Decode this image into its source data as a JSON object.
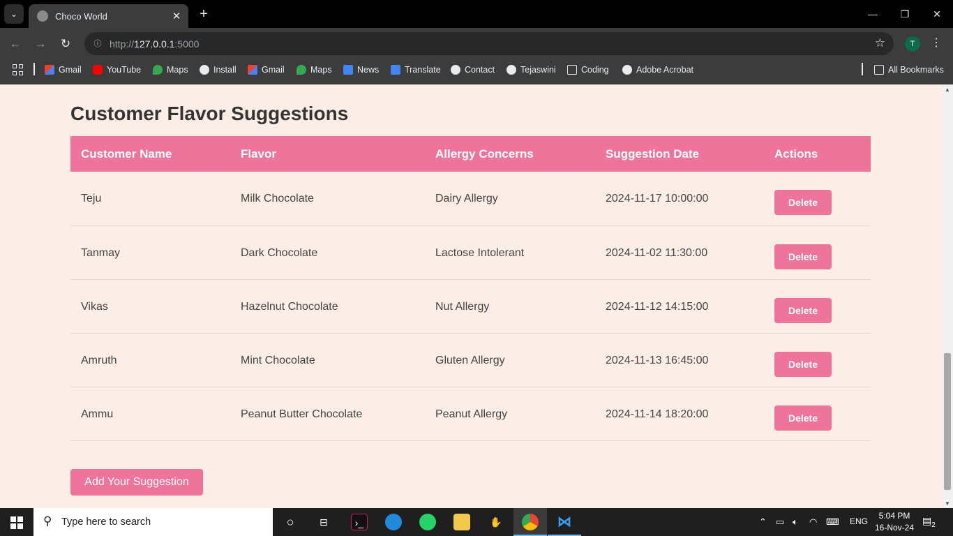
{
  "browser": {
    "tab_title": "Choco World",
    "url_scheme": "http://",
    "url_host": "127.0.0.1",
    "url_port": ":5000",
    "profile_initial": "T",
    "bookmarks": [
      {
        "label": "Gmail",
        "icon": "gmail-icon"
      },
      {
        "label": "YouTube",
        "icon": "youtube-icon"
      },
      {
        "label": "Maps",
        "icon": "maps-icon"
      },
      {
        "label": "Install",
        "icon": "globe-icon"
      },
      {
        "label": "Gmail",
        "icon": "gmail-icon"
      },
      {
        "label": "Maps",
        "icon": "maps-icon"
      },
      {
        "label": "News",
        "icon": "news-icon"
      },
      {
        "label": "Translate",
        "icon": "translate-icon"
      },
      {
        "label": "Contact",
        "icon": "globe-icon"
      },
      {
        "label": "Tejaswini",
        "icon": "globe-icon"
      },
      {
        "label": "Coding",
        "icon": "folder-icon"
      },
      {
        "label": "Adobe Acrobat",
        "icon": "globe-icon"
      }
    ],
    "all_bookmarks": "All Bookmarks"
  },
  "page": {
    "title": "Customer Flavor Suggestions",
    "columns": [
      "Customer Name",
      "Flavor",
      "Allergy Concerns",
      "Suggestion Date",
      "Actions"
    ],
    "rows": [
      {
        "name": "Teju",
        "flavor": "Milk Chocolate",
        "allergy": "Dairy Allergy",
        "date": "2024-11-17 10:00:00",
        "action": "Delete"
      },
      {
        "name": "Tanmay",
        "flavor": "Dark Chocolate",
        "allergy": "Lactose Intolerant",
        "date": "2024-11-02 11:30:00",
        "action": "Delete"
      },
      {
        "name": "Vikas",
        "flavor": "Hazelnut Chocolate",
        "allergy": "Nut Allergy",
        "date": "2024-11-12 14:15:00",
        "action": "Delete"
      },
      {
        "name": "Amruth",
        "flavor": "Mint Chocolate",
        "allergy": "Gluten Allergy",
        "date": "2024-11-13 16:45:00",
        "action": "Delete"
      },
      {
        "name": "Ammu",
        "flavor": "Peanut Butter Chocolate",
        "allergy": "Peanut Allergy",
        "date": "2024-11-14 18:20:00",
        "action": "Delete"
      }
    ],
    "add_button": "Add Your Suggestion",
    "accent_color": "#ef749b",
    "background_color": "#fcede6"
  },
  "taskbar": {
    "search_placeholder": "Type here to search",
    "language": "ENG",
    "time": "5:04 PM",
    "date": "16-Nov-24",
    "notification_count": "2"
  }
}
